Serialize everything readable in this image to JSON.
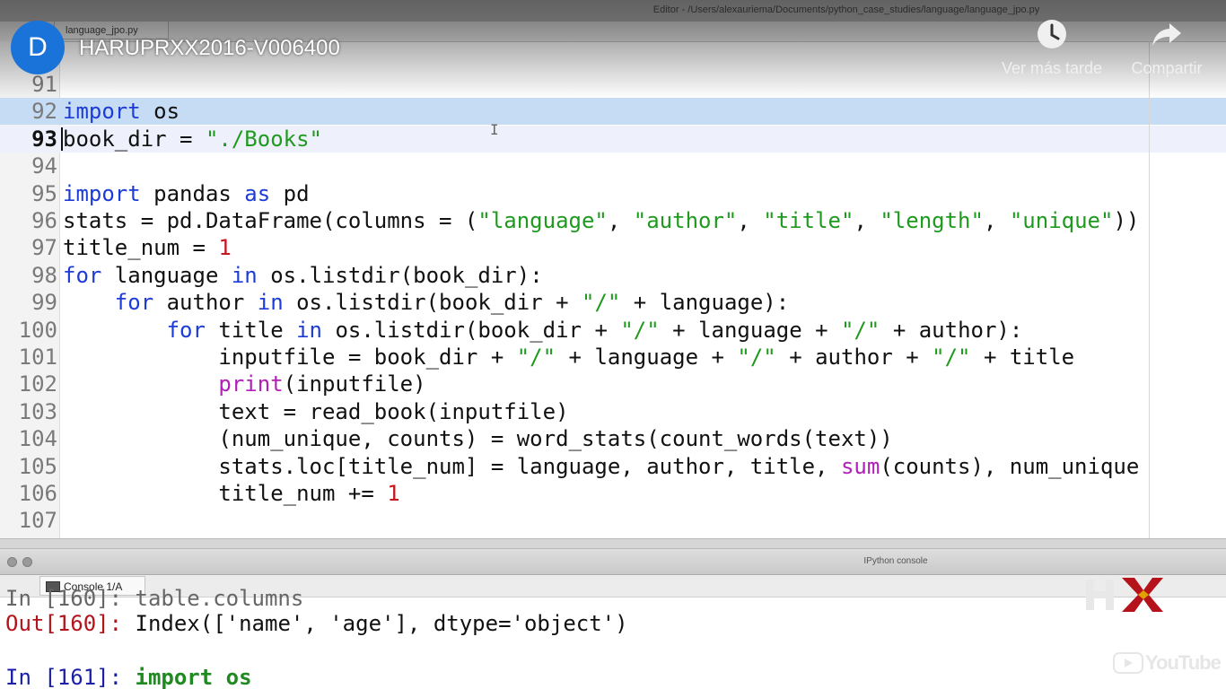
{
  "editor": {
    "window_title": "Editor - /Users/alexauriema/Documents/python_case_studies/language/language_jpo.py",
    "file_tab_label": "language_jpo.py",
    "lines": [
      {
        "num": "91",
        "code": ""
      },
      {
        "num": "92",
        "code": "import os"
      },
      {
        "num": "93",
        "code": "book_dir = \"./Books\""
      },
      {
        "num": "94",
        "code": ""
      },
      {
        "num": "95",
        "code": "import pandas as pd"
      },
      {
        "num": "96",
        "code": "stats = pd.DataFrame(columns = (\"language\", \"author\", \"title\", \"length\", \"unique\"))"
      },
      {
        "num": "97",
        "code": "title_num = 1"
      },
      {
        "num": "98",
        "code": "for language in os.listdir(book_dir):"
      },
      {
        "num": "99",
        "code": "    for author in os.listdir(book_dir + \"/\" + language):"
      },
      {
        "num": "100",
        "code": "        for title in os.listdir(book_dir + \"/\" + language + \"/\" + author):"
      },
      {
        "num": "101",
        "code": "            inputfile = book_dir + \"/\" + language + \"/\" + author + \"/\" + title"
      },
      {
        "num": "102",
        "code": "            print(inputfile)"
      },
      {
        "num": "103",
        "code": "            text = read_book(inputfile)"
      },
      {
        "num": "104",
        "code": "            (num_unique, counts) = word_stats(count_words(text))"
      },
      {
        "num": "105",
        "code": "            stats.loc[title_num] = language, author, title, sum(counts), num_unique"
      },
      {
        "num": "106",
        "code": "            title_num += 1"
      },
      {
        "num": "107",
        "code": ""
      }
    ],
    "selected_line": "92",
    "current_line": "93"
  },
  "console": {
    "window_title": "IPython console",
    "tab_label": "Console 1/A",
    "partial_line": "In [160]: table.columns",
    "out_prompt": "Out[160]:",
    "out_text": " Index(['name', 'age'], dtype='object')",
    "in_prompt": "In [161]:",
    "in_code": "import os"
  },
  "overlay": {
    "channel_initial": "D",
    "video_title": "HARUPRXX2016-V006400",
    "watch_later_label": "Ver más tarde",
    "share_label": "Compartir",
    "youtube_logo_text": "YouTube"
  },
  "colors": {
    "keyword": "#1d3bd6",
    "string": "#1f9a1f",
    "number": "#c8141c",
    "builtin": "#b01fb8",
    "selection": "#c6dcf5",
    "avatar": "#1a73d9"
  }
}
